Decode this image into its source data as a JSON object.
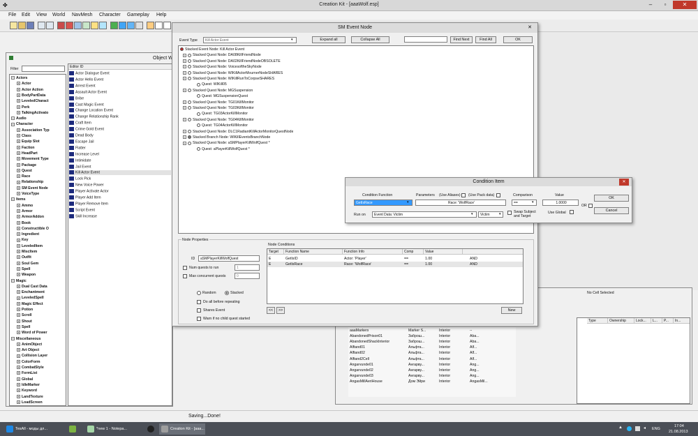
{
  "app_title": "Creation Kit - [aaaWolf.esp]",
  "menu": [
    "File",
    "Edit",
    "View",
    "World",
    "NavMesh",
    "Character",
    "Gameplay",
    "Help"
  ],
  "object_window": {
    "title": "Object W",
    "filter_label": "Filter",
    "tree": [
      "Actors",
      "Actor",
      "Actor Action",
      "BodyPartData",
      "LeveledCharact",
      "Perk",
      "TalkingActivato",
      "Audio",
      "Character",
      "Association Typ",
      "Class",
      "Equip Slot",
      "Faction",
      "HeadPart",
      "Movement Type",
      "Package",
      "Quest",
      "Race",
      "Relationship",
      "SM Event Node",
      "VoiceType",
      "Items",
      "Ammo",
      "Armor",
      "ArmorAddon",
      "Book",
      "Constructible O",
      "Ingredient",
      "Key",
      "LeveledItem",
      "MiscItem",
      "Outfit",
      "Soul Gem",
      "Spell",
      "Weapon",
      "Magic",
      "Dual Cast Data",
      "Enchantment",
      "LeveledSpell",
      "Magic Effect",
      "Potion",
      "Scroll",
      "Shout",
      "Spell",
      "Word of Power",
      "Miscellaneous",
      "AnimObject",
      "Art Object",
      "Collision Layer",
      "ColorForm",
      "CombatStyle",
      "FormList",
      "Global",
      "IdleMarker",
      "Keyword",
      "LandTexture",
      "LoadScreen"
    ],
    "editor_header": "Editor ID",
    "editor_items": [
      "Actor Dialogue Event",
      "Actor Hello Event",
      "Arrest Event",
      "Assault Actor Event",
      "Bribe",
      "Cast Magic Event",
      "Change Location Event",
      "Change Relationship Rank",
      "Craft Item",
      "Crime Gold Event",
      "Dead Body",
      "Escape Jail",
      "Flatter",
      "Increase Level",
      "Intimidate",
      "Jail Event",
      "Kill Actor Event",
      "Lock Pick",
      "New Voice Power",
      "Player Activate Actor",
      "Player Add Item",
      "Player Remove Item",
      "Script Event",
      "Skill Increase"
    ]
  },
  "sm_event": {
    "title": "SM Event Node",
    "event_type_label": "Event Type",
    "event_type_value": "Kill Actor Event",
    "expand_all": "Expand all",
    "collapse_all": "Collapse All",
    "find_next": "Find Next",
    "find_all": "Find All",
    "ok": "OK",
    "nodes": [
      "Stacked Event Node: Kill Actor Event",
      "Stacked Quest Node: DA08KillFriendNode",
      "Stacked Quest Node: DA02KillFriendNodeOBSOLETE",
      "Stacked Quest Node: VoicesoftheSkyNode",
      "Stacked Quest Node: WIKillActorMournerNodeSHARES",
      "Stacked Quest Node: WIKillRunToCorpseSHARES",
      "Quest: WIKill05",
      "Stacked Quest Node: MGSuspension",
      "Quest: MGSuspensionQuest",
      "Stacked Quest Node: TG01KillMonitor",
      "Stacked Quest Node: TG03KillMonitor",
      "Quest: TG03ActorKillMonitor",
      "Stacked Quest Node: TG04KillMonitor",
      "Quest: TG04ActorKillMonitor",
      "Stacked Quest Node: DLC1RadiantKillActorMonitorQuestNode",
      "Stacked Branch Node: WIKillEventsBranchNode",
      "Stacked Quest Node: aSMPlayerKillWolfQuest *",
      "Quest: aPlayerKillWolfQuest *"
    ],
    "node_properties_label": "Node Properties",
    "id_label": "ID",
    "id_value": "aSMPlayerKillWolfQuest",
    "num_quests_label": "Num quests to run",
    "num_quests_value": "1",
    "max_concurrent_label": "Max concurrent quests",
    "max_concurrent_value": "0",
    "random_label": "Random",
    "stacked_label": "Stacked",
    "do_all_label": "Do all before repeating",
    "shares_event_label": "Shares Event",
    "warn_label": "Warn if no child quest started",
    "node_conditions_label": "Node Conditions",
    "cond_headers": [
      "Target",
      "Function Name",
      "Function Info",
      "Comp",
      "Value",
      ""
    ],
    "cond_rows": [
      [
        "E",
        "GetIsID",
        "Actor: 'Player'",
        "==",
        "1.00",
        "AND"
      ],
      [
        "E",
        "GetIsRace",
        "Race: 'WolfRace'",
        "==",
        "1.00",
        "AND"
      ]
    ],
    "prev_btn": "<<",
    "next_btn": ">>",
    "new_btn": "New"
  },
  "condition_item": {
    "title": "Condition Item",
    "function_label": "Condition Function",
    "parameters_label": "Parameters",
    "use_aliases_label": "(Use Aliases)",
    "use_pack_label": "(Use Pack data)",
    "comparison_label": "Comparison",
    "value_label": "Value",
    "function_value": "GetIsRace",
    "param_value": "Race: 'WolfRace'",
    "comparison_value": "==",
    "value_value": "1.0000",
    "or_label": "OR",
    "ok": "OK",
    "cancel": "Cancel",
    "run_on_label": "Run on",
    "run_on_value": "Event Data: Victim",
    "victim_value": "Victim",
    "swap_label": "Swap Subject and Target",
    "use_global_label": "Use Global"
  },
  "cell_view": {
    "no_cell": "No Cell Selected",
    "headers": [
      "Type",
      "Ownership",
      "Lock...",
      "L...",
      "P...",
      "In..."
    ],
    "rows": [
      [
        "aaaMarkers",
        "Marker S...",
        "Interior",
        "--"
      ],
      [
        "AbandonedPrison01",
        "Заброш...",
        "Interior",
        "Aba..."
      ],
      [
        "AbandonedShackInterior",
        "Заброш...",
        "Interior",
        "Aba..."
      ],
      [
        "Alftand01",
        "Альфта...",
        "Interior",
        "Alf..."
      ],
      [
        "Alftand02",
        "Альфта...",
        "Interior",
        "Alf..."
      ],
      [
        "Alftand2Cell",
        "Альфта...",
        "Interior",
        "Alf..."
      ],
      [
        "Angarvunde01",
        "Ангарву...",
        "Interior",
        "Ang..."
      ],
      [
        "Angarvunde02",
        "Ангарву...",
        "Interior",
        "Ang..."
      ],
      [
        "Angarvunde03",
        "Ангарву...",
        "Interior",
        "Ang..."
      ],
      [
        "AngasMillAeriHouse",
        "Дом Эйри",
        "Interior",
        "AngasMil..."
      ]
    ]
  },
  "status": "Saving...Done!",
  "taskbar": {
    "items": [
      "TesAll - моды дл...",
      "",
      "*new 1 - Notepa...",
      "",
      "Creation Kit - [aaa..."
    ],
    "lang": "ENG",
    "time": "17:04",
    "date": "21.08.2013"
  },
  "colors": {
    "accent": "#1c2a7c",
    "selection": "#3399ff",
    "close": "#c0392b"
  }
}
